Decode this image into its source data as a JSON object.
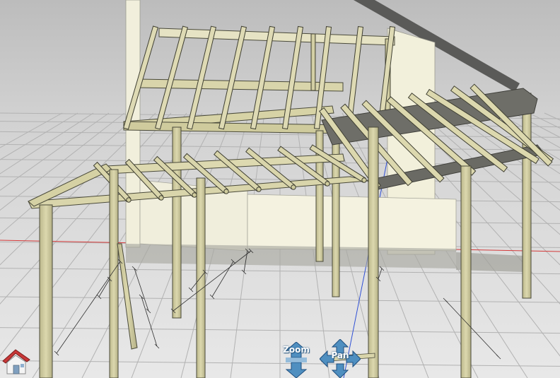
{
  "viewport": {
    "background_top": "#bfbfbf",
    "background_bottom": "#e6e6e6",
    "grid_color": "#b0b0b0",
    "axis_x_color": "#d32020",
    "axis_y_color": "#2040d0"
  },
  "colors": {
    "timber": "#d7d3a6",
    "timber_edge": "#4a4a3a",
    "wall": "#f3f1de",
    "roof_beam": "#6b6b66"
  },
  "icons": {
    "home": "home-icon",
    "zoom": "zoom-icon",
    "pan": "pan-icon"
  },
  "navigation": {
    "zoom_label": "Zoom",
    "pan_label": "Pan"
  }
}
